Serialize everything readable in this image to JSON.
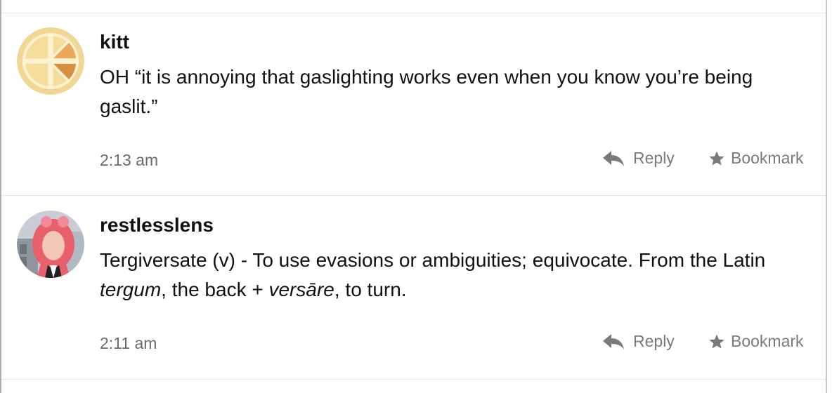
{
  "posts": [
    {
      "username": "kitt",
      "text": "OH “it is annoying that gaslighting works even when you know you’re being gaslit.”",
      "time": "2:13 am",
      "reply_label": "Reply",
      "bookmark_label": "Bookmark",
      "avatar_icon": "orange-slice-avatar"
    },
    {
      "username": "restlesslens",
      "text_parts": {
        "a": "Tergiversate (v) - To use evasions or ambiguities; equivocate. From the Latin ",
        "b": "tergum",
        "c": ", the back + ",
        "d": "versāre",
        "e": ", to turn."
      },
      "time": "2:11 am",
      "reply_label": "Reply",
      "bookmark_label": "Bookmark",
      "avatar_icon": "pink-hair-person-avatar"
    }
  ],
  "colors": {
    "accent_orange": "#e8a85a",
    "muted_text": "#7a7a7a"
  }
}
